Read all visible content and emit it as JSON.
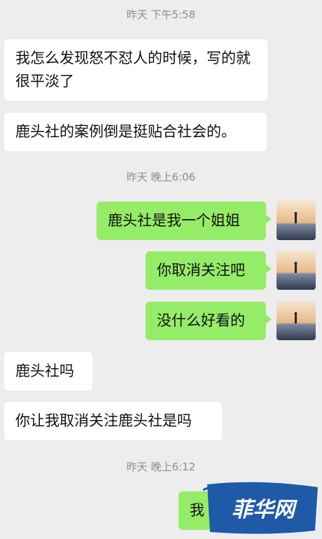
{
  "timestamps": [
    "昨天 下午5:58",
    "昨天 晚上6:06",
    "昨天 晚上6:12"
  ],
  "messages": [
    {
      "side": "left",
      "text": "我怎么发现怒不怼人的时候，写的就很平淡了"
    },
    {
      "side": "left",
      "text": "鹿头社的案例倒是挺贴合社会的。"
    },
    {
      "side": "right",
      "text": "鹿头社是我一个姐姐"
    },
    {
      "side": "right",
      "text": "你取消关注吧"
    },
    {
      "side": "right",
      "text": "没什么好看的"
    },
    {
      "side": "left",
      "text": "鹿头社吗"
    },
    {
      "side": "left",
      "text": "你让我取消关注鹿头社是吗"
    },
    {
      "side": "right",
      "text": "我"
    }
  ],
  "watermark": {
    "text": "菲华网"
  },
  "colors": {
    "background": "#ededed",
    "sent_bubble": "#95ec69",
    "received_bubble": "#ffffff"
  }
}
